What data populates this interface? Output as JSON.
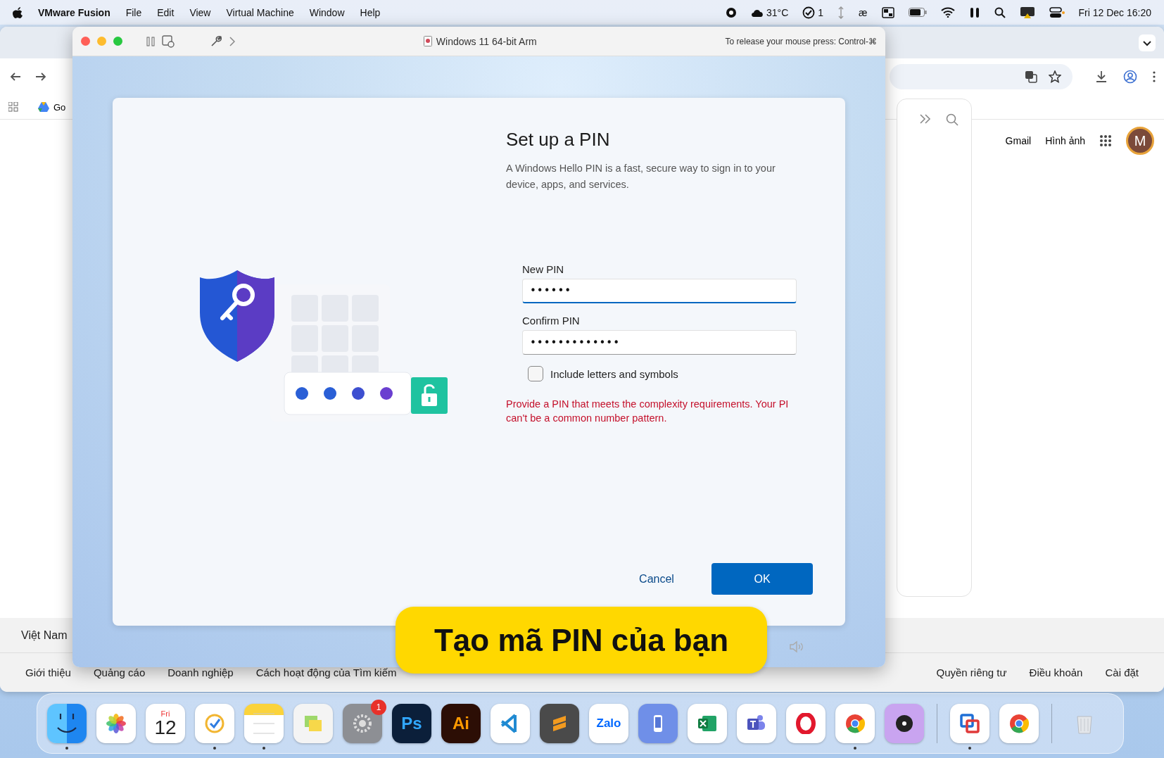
{
  "menu_bar": {
    "app_name": "VMware Fusion",
    "menus": [
      "File",
      "Edit",
      "View",
      "Virtual Machine",
      "Window",
      "Help"
    ],
    "weather": "31°C",
    "tasks_count": "1",
    "input_method": "æ",
    "clock": "Fri 12 Dec  16:20"
  },
  "browser": {
    "bookmark": "Go",
    "header_links": [
      "Gmail",
      "Hình ảnh"
    ],
    "avatar": "M",
    "country": "Việt Nam",
    "footer_left": [
      "Giới thiệu",
      "Quảng cáo",
      "Doanh nghiệp",
      "Cách hoạt động của Tìm kiếm"
    ],
    "footer_right": [
      "Quyền riêng tư",
      "Điều khoản",
      "Cài đặt"
    ]
  },
  "vm_window": {
    "title": "Windows 11 64-bit Arm",
    "release_hint": "To release your mouse press: Control-⌘"
  },
  "dialog": {
    "title": "Set up a PIN",
    "description": "A Windows Hello PIN is a fast, secure way to sign in to your device, apps, and services.",
    "fields": [
      {
        "label": "New PIN",
        "value": "••••••",
        "focused": true
      },
      {
        "label": "Confirm PIN",
        "value": "•••••••••••••",
        "focused": false
      }
    ],
    "checkbox": {
      "label": "Include letters and symbols",
      "checked": false
    },
    "error": "Provide a PIN that meets the complexity requirements. Your PI\ncan't be a common number pattern.",
    "buttons": [
      {
        "label": "Cancel",
        "kind": "secondary"
      },
      {
        "label": "OK",
        "kind": "primary"
      }
    ]
  },
  "caption": "Tạo mã PIN của bạn",
  "dock": {
    "items": [
      {
        "kind": "finder",
        "running": true
      },
      {
        "kind": "photos",
        "running": false
      },
      {
        "kind": "calendar",
        "day": "Fri",
        "date": "12",
        "running": false
      },
      {
        "kind": "reminders",
        "running": true
      },
      {
        "kind": "notes",
        "running": true
      },
      {
        "kind": "stickies",
        "running": false
      },
      {
        "kind": "settings",
        "badge": "1",
        "running": false
      },
      {
        "kind": "ps",
        "text": "Ps",
        "running": false
      },
      {
        "kind": "ai",
        "text": "Ai",
        "running": false
      },
      {
        "kind": "code",
        "running": false
      },
      {
        "kind": "sublime",
        "running": false
      },
      {
        "kind": "zalo",
        "text": "Zalo",
        "running": false
      },
      {
        "kind": "phone",
        "running": false
      },
      {
        "kind": "excel",
        "running": false
      },
      {
        "kind": "teams",
        "running": false
      },
      {
        "kind": "opera",
        "running": false
      },
      {
        "kind": "chrome",
        "running": true
      },
      {
        "kind": "music",
        "running": false
      },
      {
        "kind": "separator"
      },
      {
        "kind": "vmware",
        "running": true
      },
      {
        "kind": "chrome_app",
        "running": false
      },
      {
        "kind": "separator"
      },
      {
        "kind": "trash",
        "running": false
      }
    ]
  }
}
